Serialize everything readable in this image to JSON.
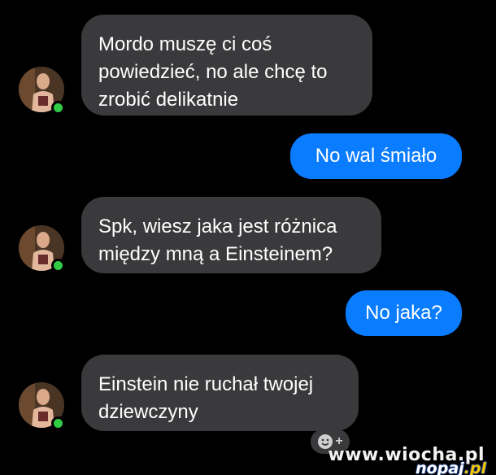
{
  "conversation": {
    "messages": [
      {
        "sender": "contact",
        "text": "Mordo muszę ci coś\npowiedzieć, no ale chcę to\nzrobić delikatnie"
      },
      {
        "sender": "me",
        "text": "No wal śmiało"
      },
      {
        "sender": "contact",
        "text": "Spk, wiesz jaka jest różnica\nmiędzy mną a Einsteinem?"
      },
      {
        "sender": "me",
        "text": "No jaka?"
      },
      {
        "sender": "contact",
        "text": "Einstein nie ruchał twojej\ndziewczyny"
      }
    ]
  },
  "contact": {
    "presence": "online",
    "avatar_icon": "profile-photo"
  },
  "reaction_button": {
    "icon": "smiley-plus-icon",
    "label": "+"
  },
  "watermark": {
    "text": "www.wiocha.pl",
    "logo_name": "nopaj",
    "logo_tld": ".pl"
  },
  "colors": {
    "background": "#000000",
    "incoming_bubble": "#3a3a3c",
    "outgoing_bubble": "#0a7cff",
    "presence": "#31cc46"
  }
}
